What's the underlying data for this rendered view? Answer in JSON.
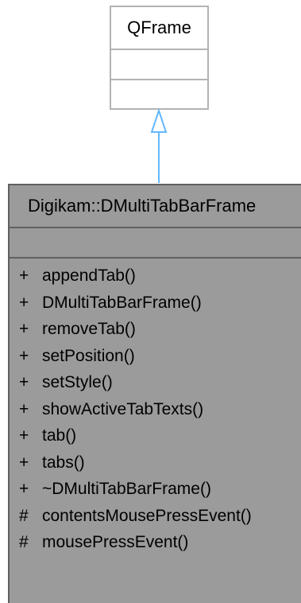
{
  "parent_class": {
    "name": "QFrame"
  },
  "class": {
    "name": "Digikam::DMultiTabBarFrame",
    "methods": [
      {
        "visibility": "+",
        "name": "appendTab()"
      },
      {
        "visibility": "+",
        "name": "DMultiTabBarFrame()"
      },
      {
        "visibility": "+",
        "name": "removeTab()"
      },
      {
        "visibility": "+",
        "name": "setPosition()"
      },
      {
        "visibility": "+",
        "name": "setStyle()"
      },
      {
        "visibility": "+",
        "name": "showActiveTabTexts()"
      },
      {
        "visibility": "+",
        "name": "tab()"
      },
      {
        "visibility": "+",
        "name": "tabs()"
      },
      {
        "visibility": "+",
        "name": "~DMultiTabBarFrame()"
      },
      {
        "visibility": "#",
        "name": "contentsMousePressEvent()"
      },
      {
        "visibility": "#",
        "name": "mousePressEvent()"
      }
    ]
  },
  "colors": {
    "parent_border": "#b3b3b3",
    "class_fill": "#9b9b9b",
    "class_border": "#606060",
    "inheritance_arrow": "#63b8ff"
  }
}
